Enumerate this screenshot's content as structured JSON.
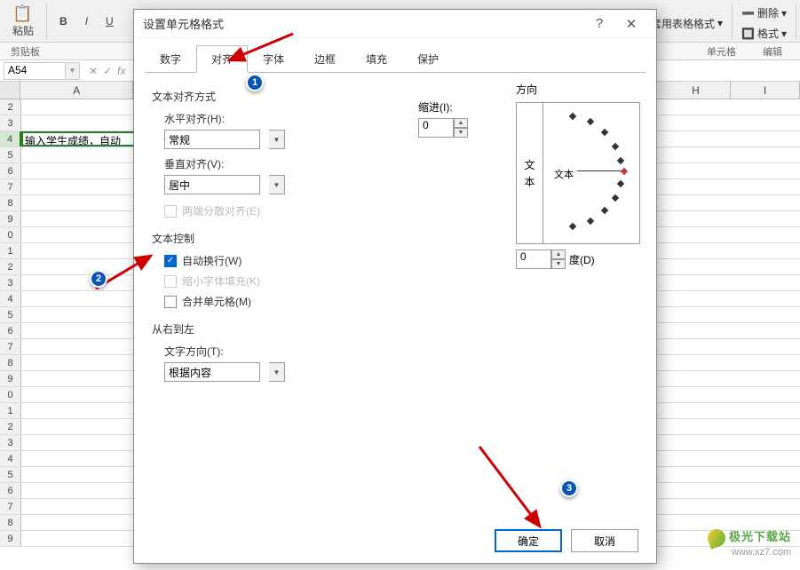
{
  "ribbon": {
    "bold": "B",
    "italic": "I",
    "underline": "U",
    "paste_lbl": "粘贴",
    "clipboard_lbl": "剪贴板",
    "tablefmt": "套用表格格式",
    "format": "格式",
    "delete": "删除",
    "cells_grp": "单元格",
    "edit_grp": "编辑"
  },
  "namebox": "A54",
  "sheet": {
    "cols": [
      "A",
      "H",
      "I"
    ],
    "a_cell": "输入学生成绩，自动"
  },
  "dialog": {
    "title": "设置单元格格式",
    "tabs": [
      "数字",
      "对齐",
      "字体",
      "边框",
      "填充",
      "保护"
    ],
    "active_tab": "对齐",
    "align_group": "文本对齐方式",
    "h_align_lbl": "水平对齐(H):",
    "h_align_val": "常规",
    "v_align_lbl": "垂直对齐(V):",
    "v_align_val": "居中",
    "indent_lbl": "缩进(I):",
    "indent_val": "0",
    "justify_lbl": "两端分散对齐(E)",
    "textctrl_group": "文本控制",
    "wrap_lbl": "自动换行(W)",
    "shrink_lbl": "缩小字体填充(K)",
    "merge_lbl": "合并单元格(M)",
    "rtl_group": "从右到左",
    "textdir_lbl": "文字方向(T):",
    "textdir_val": "根据内容",
    "orient_lbl": "方向",
    "orient_v1": "文",
    "orient_v2": "本",
    "orient_text": "文本",
    "degree_val": "0",
    "degree_lbl": "度(D)",
    "ok": "确定",
    "cancel": "取消"
  },
  "markers": {
    "m1": "1",
    "m2": "2",
    "m3": "3"
  },
  "watermark": {
    "cn": "极光下载站",
    "url": "www.xz7.com"
  }
}
